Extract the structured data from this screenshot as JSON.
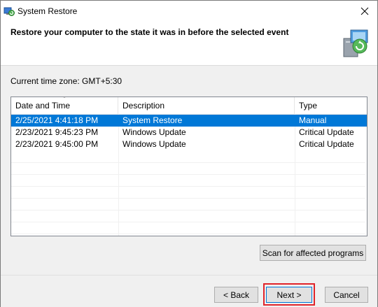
{
  "window": {
    "title": "System Restore",
    "icon": "system-restore-icon"
  },
  "header": {
    "title": "Restore your computer to the state it was in before the selected event",
    "icon": "system-restore-computer-icon"
  },
  "timezone": "Current time zone: GMT+5:30",
  "table": {
    "columns": [
      "Date and Time",
      "Description",
      "Type"
    ],
    "rows": [
      {
        "date": "2/25/2021 4:41:18 PM",
        "description": "System Restore",
        "type": "Manual",
        "selected": true
      },
      {
        "date": "2/23/2021 9:45:23 PM",
        "description": "Windows Update",
        "type": "Critical Update",
        "selected": false
      },
      {
        "date": "2/23/2021 9:45:00 PM",
        "description": "Windows Update",
        "type": "Critical Update",
        "selected": false
      }
    ]
  },
  "buttons": {
    "scan": "Scan for affected programs",
    "back": "< Back",
    "next": "Next >",
    "cancel": "Cancel"
  },
  "colors": {
    "selection": "#0078d7",
    "highlight": "#e0242a"
  }
}
